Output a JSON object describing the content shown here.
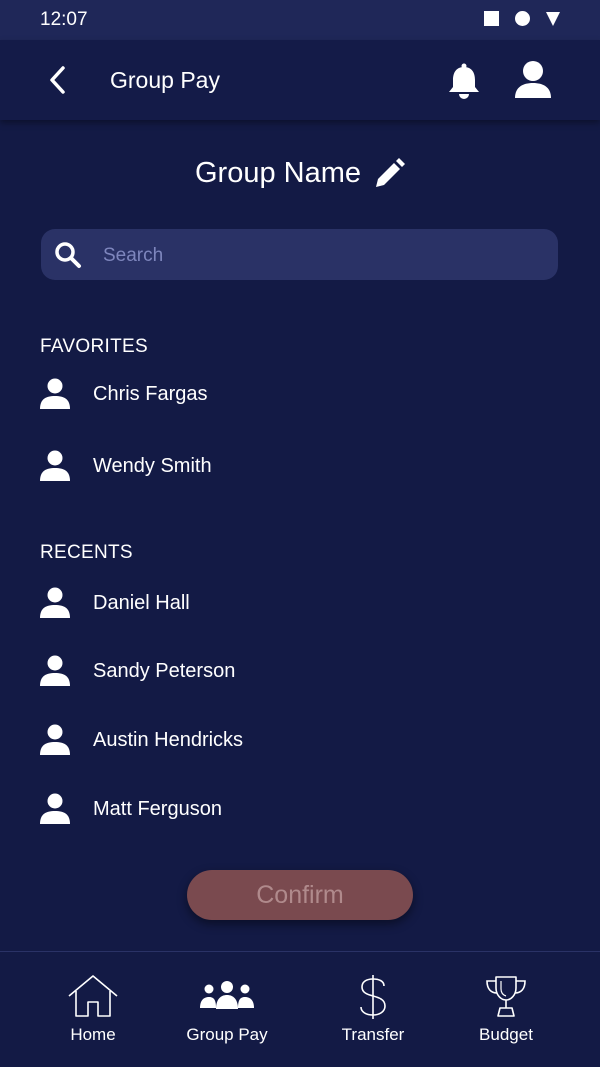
{
  "status_bar": {
    "time": "12:07",
    "icons": [
      "square-icon",
      "circle-icon",
      "triangle-icon"
    ]
  },
  "header": {
    "title": "Group Pay",
    "icons": [
      "back-icon",
      "bell-icon",
      "user-icon"
    ]
  },
  "group": {
    "name": "Group Name",
    "edit_icon": "pencil-icon"
  },
  "search": {
    "placeholder": "Search",
    "value": ""
  },
  "favorites": {
    "heading": "FAVORITES",
    "contacts": [
      "Chris Fargas",
      "Wendy Smith"
    ]
  },
  "recents": {
    "heading": "RECENTS",
    "contacts": [
      "Daniel Hall",
      "Sandy Peterson",
      "Austin Hendricks",
      "Matt Ferguson"
    ]
  },
  "confirm_label": "Confirm",
  "nav": {
    "items": [
      {
        "label": "Home",
        "icon": "home-icon"
      },
      {
        "label": "Group Pay",
        "icon": "group-icon"
      },
      {
        "label": "Transfer",
        "icon": "dollar-icon"
      },
      {
        "label": "Budget",
        "icon": "trophy-icon"
      }
    ]
  },
  "colors": {
    "background": "#131a45",
    "header": "#141b48",
    "search_bg": "#2a3266",
    "confirm_bg": "#7a4a4f",
    "confirm_text": "#b08a8c",
    "placeholder": "#7e86bd"
  }
}
